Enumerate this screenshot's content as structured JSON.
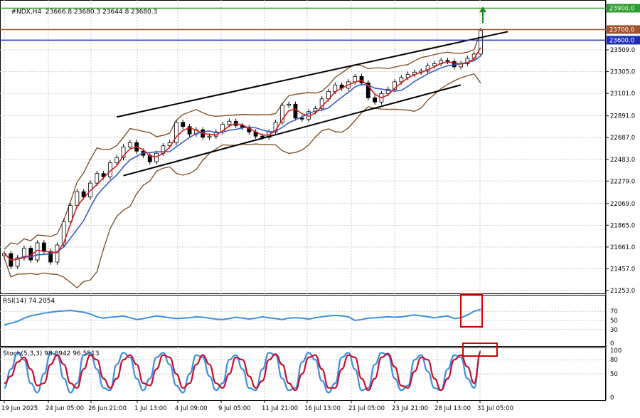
{
  "header": {
    "symbol": "#NDX,H4",
    "ohlc": "23666.8 23680.3 23644.8 23680.3"
  },
  "price_pane": {
    "y_ticks": [
      "23509.0",
      "23305.0",
      "23101.0",
      "22891.0",
      "22687.0",
      "22483.0",
      "22279.0",
      "22069.0",
      "21865.0",
      "21661.0",
      "21457.0",
      "21253.0"
    ],
    "levels": [
      {
        "label": "23900.0",
        "value": 23900,
        "color": "#2e9c2e"
      },
      {
        "label": "23700.0",
        "value": 23700,
        "color": "#a0522d"
      },
      {
        "label": "23600.0",
        "value": 23600,
        "color": "#1f2fb5"
      }
    ]
  },
  "rsi_pane": {
    "label": "RSI(14) 74.2054",
    "y_ticks": [
      "70",
      "50",
      "30",
      "0"
    ]
  },
  "stoch_pane": {
    "label": "Stoch(5,3,3) 98.8942 96.5513",
    "y_ticks": [
      "100",
      "80",
      "50",
      "0"
    ]
  },
  "x_axis": {
    "labels": [
      "19 Jun 2025",
      "24 Jun 05:00",
      "26 Jun 21:00",
      "1 Jul 13:00",
      "4 Jul 09:00",
      "9 Jul 05:00",
      "11 Jul 21:00",
      "16 Jul 13:00",
      "21 Jul 05:00",
      "23 Jul 21:00",
      "28 Jul 13:00",
      "31 Jul 05:00"
    ]
  },
  "colors": {
    "ma_fast": "#d81b1b",
    "ma_slow": "#3a5ec2",
    "bollinger": "#7a4a1c",
    "rsi_line": "#3d8fe0",
    "stoch_main": "#3d8fe0",
    "stoch_signal": "#c8102e",
    "highlight_box": "#d00000",
    "target_arrow": "#1a8a1a"
  },
  "chart_data": {
    "type": "line",
    "symbol": "#NDX",
    "timeframe": "H4",
    "x_labels": [
      "19 Jun 2025",
      "24 Jun 05:00",
      "26 Jun 21:00",
      "1 Jul 13:00",
      "4 Jul 09:00",
      "9 Jul 05:00",
      "11 Jul 21:00",
      "16 Jul 13:00",
      "21 Jul 05:00",
      "23 Jul 21:00",
      "28 Jul 13:00",
      "31 Jul 05:00"
    ],
    "ylim": [
      21253,
      23950
    ],
    "series": [
      {
        "name": "close",
        "values": [
          21600,
          21480,
          21560,
          21650,
          21540,
          21700,
          21620,
          21520,
          21680,
          21900,
          22050,
          22180,
          22130,
          22260,
          22350,
          22320,
          22450,
          22500,
          22600,
          22640,
          22560,
          22520,
          22460,
          22540,
          22610,
          22640,
          22830,
          22790,
          22720,
          22760,
          22690,
          22700,
          22740,
          22810,
          22840,
          22800,
          22780,
          22740,
          22700,
          22690,
          22740,
          22830,
          22990,
          23000,
          22870,
          22860,
          22930,
          22960,
          23050,
          23120,
          23180,
          23150,
          23210,
          23260,
          23200,
          23060,
          23020,
          23100,
          23140,
          23210,
          23250,
          23280,
          23300,
          23310,
          23360,
          23380,
          23410,
          23400,
          23350,
          23380,
          23430,
          23470,
          23690
        ]
      }
    ],
    "rsi": {
      "ylim": [
        0,
        100
      ],
      "values": [
        40,
        44,
        48,
        55,
        60,
        63,
        66,
        68,
        70,
        71,
        72,
        70,
        68,
        64,
        58,
        55,
        57,
        58,
        60,
        56,
        52,
        54,
        57,
        60,
        58,
        56,
        54,
        55,
        56,
        58,
        57,
        55,
        53,
        52,
        54,
        57,
        55,
        53,
        55,
        58,
        56,
        54,
        52,
        55,
        56,
        55,
        53,
        56,
        58,
        60,
        61,
        60,
        58,
        50,
        52,
        55,
        56,
        57,
        58,
        57,
        58,
        60,
        62,
        60,
        58,
        56,
        58,
        60,
        54,
        56,
        62,
        70,
        74.2054
      ]
    },
    "stochastic": {
      "ylim": [
        0,
        100
      ],
      "main": [
        20,
        60,
        95,
        80,
        30,
        10,
        50,
        95,
        90,
        40,
        10,
        30,
        90,
        95,
        60,
        20,
        15,
        70,
        95,
        85,
        40,
        15,
        40,
        85,
        95,
        70,
        25,
        10,
        50,
        90,
        85,
        45,
        15,
        30,
        80,
        90,
        60,
        20,
        15,
        60,
        95,
        90,
        40,
        15,
        20,
        75,
        95,
        80,
        35,
        10,
        30,
        85,
        95,
        60,
        15,
        20,
        70,
        95,
        90,
        40,
        15,
        25,
        80,
        90,
        55,
        20,
        15,
        60,
        90,
        85,
        40,
        20,
        98.8942
      ],
      "signal": [
        30,
        45,
        75,
        85,
        60,
        25,
        30,
        70,
        90,
        70,
        30,
        20,
        60,
        90,
        80,
        40,
        20,
        40,
        80,
        90,
        70,
        30,
        25,
        60,
        90,
        85,
        50,
        20,
        30,
        70,
        90,
        70,
        30,
        20,
        50,
        85,
        80,
        45,
        20,
        35,
        80,
        92,
        70,
        30,
        15,
        50,
        85,
        90,
        60,
        20,
        20,
        60,
        90,
        85,
        40,
        15,
        40,
        85,
        93,
        65,
        25,
        20,
        55,
        85,
        80,
        40,
        15,
        40,
        80,
        90,
        65,
        30,
        96.5513
      ]
    }
  }
}
